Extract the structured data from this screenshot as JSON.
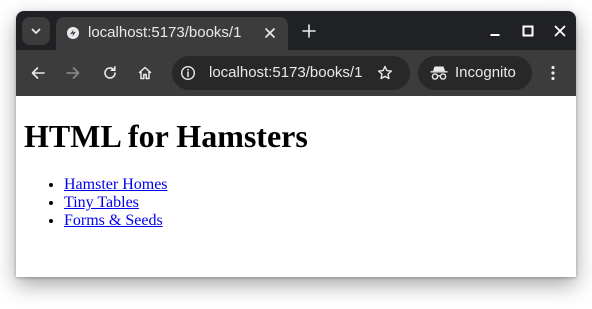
{
  "browser": {
    "tab": {
      "title": "localhost:5173/books/1"
    },
    "address_bar": {
      "url": "localhost:5173/books/1"
    },
    "incognito_label": "Incognito"
  },
  "icons": {
    "tab_search": "chevron-down-icon",
    "favicon": "vite-favicon",
    "tab_close": "close-icon",
    "new_tab": "plus-icon",
    "minimize": "minimize-icon",
    "maximize": "maximize-icon",
    "close_window": "close-icon",
    "back": "arrow-left-icon",
    "forward": "arrow-right-icon",
    "reload": "reload-icon",
    "home": "home-icon",
    "site_info": "info-icon",
    "bookmark": "star-icon",
    "incognito": "incognito-icon",
    "menu": "more-vert-icon"
  },
  "colors": {
    "tab_strip": "#202124",
    "toolbar": "#3c3c3c",
    "omnibox": "#282828",
    "link": "#0000ee"
  },
  "page": {
    "heading": "HTML for Hamsters",
    "links": [
      {
        "label": "Hamster Homes"
      },
      {
        "label": "Tiny Tables"
      },
      {
        "label": "Forms & Seeds"
      }
    ]
  }
}
